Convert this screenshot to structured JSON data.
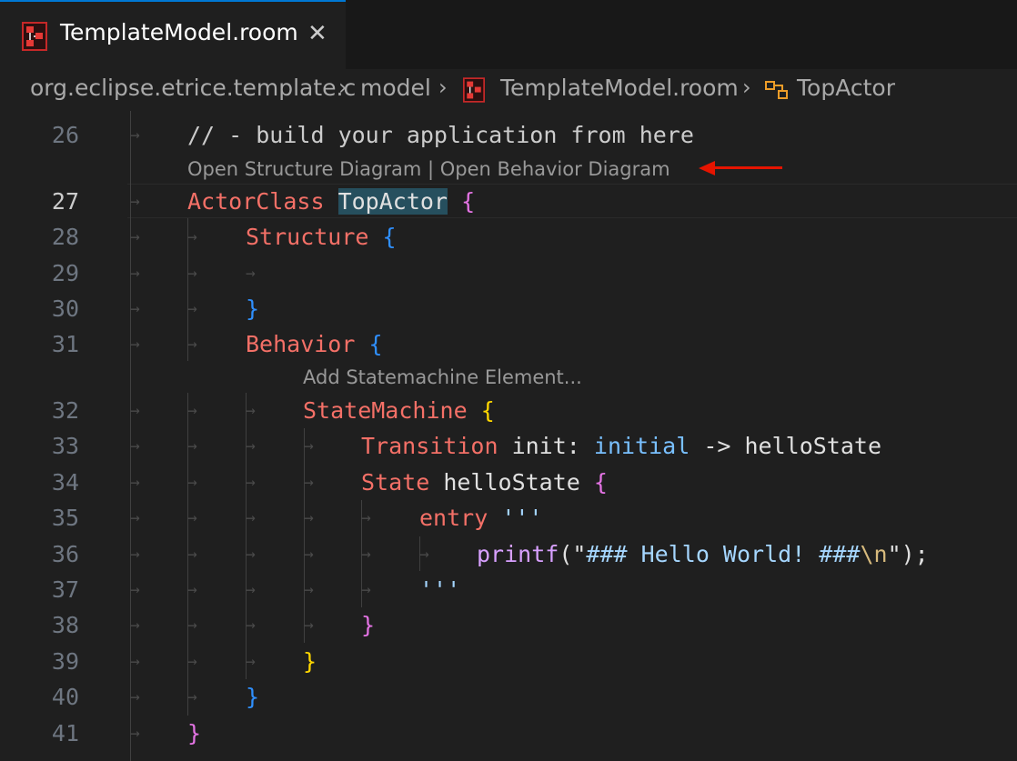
{
  "tab": {
    "title": "TemplateModel.room",
    "close_glyph": "✕",
    "icon": "room-file-icon"
  },
  "breadcrumb": {
    "items": [
      "org.eclipse.etrice.template.c",
      "model",
      "TemplateModel.room",
      "TopActor"
    ],
    "separator": "›"
  },
  "editor": {
    "line_numbers": [
      "26",
      "27",
      "28",
      "29",
      "30",
      "31",
      "32",
      "33",
      "34",
      "35",
      "36",
      "37",
      "38",
      "39",
      "40",
      "41"
    ],
    "active_line": "27",
    "codelens_structure": "Open Structure Diagram",
    "codelens_separator": " | ",
    "codelens_behavior": "Open Behavior Diagram",
    "codelens_statemachine": "Add Statemachine Element...",
    "tokens": {
      "comment": "// - build your application from here",
      "actorclass_kw": "ActorClass",
      "actor_name": "TopActor",
      "structure_kw": "Structure",
      "behavior_kw": "Behavior",
      "statemachine_kw": "StateMachine",
      "transition_kw": "Transition",
      "transition_rest": "init:",
      "initial_kw": "initial",
      "arrow_op": "->",
      "target_state": "helloState",
      "state_kw": "State",
      "state_name": "helloState",
      "entry_kw": "entry",
      "triple_quote": "'''",
      "printf_fn": "printf",
      "printf_open": "(\"",
      "printf_str": "### Hello World! ###",
      "printf_esc": "\\n",
      "printf_close": "\");",
      "open_brace": "{",
      "close_brace": "}"
    }
  },
  "colors": {
    "keyword": "#f47067",
    "bracket_level1": "#e373e3",
    "bracket_level2": "#2f8ffd",
    "bracket_level3": "#ffd700",
    "annotation_arrow": "#e51400"
  }
}
